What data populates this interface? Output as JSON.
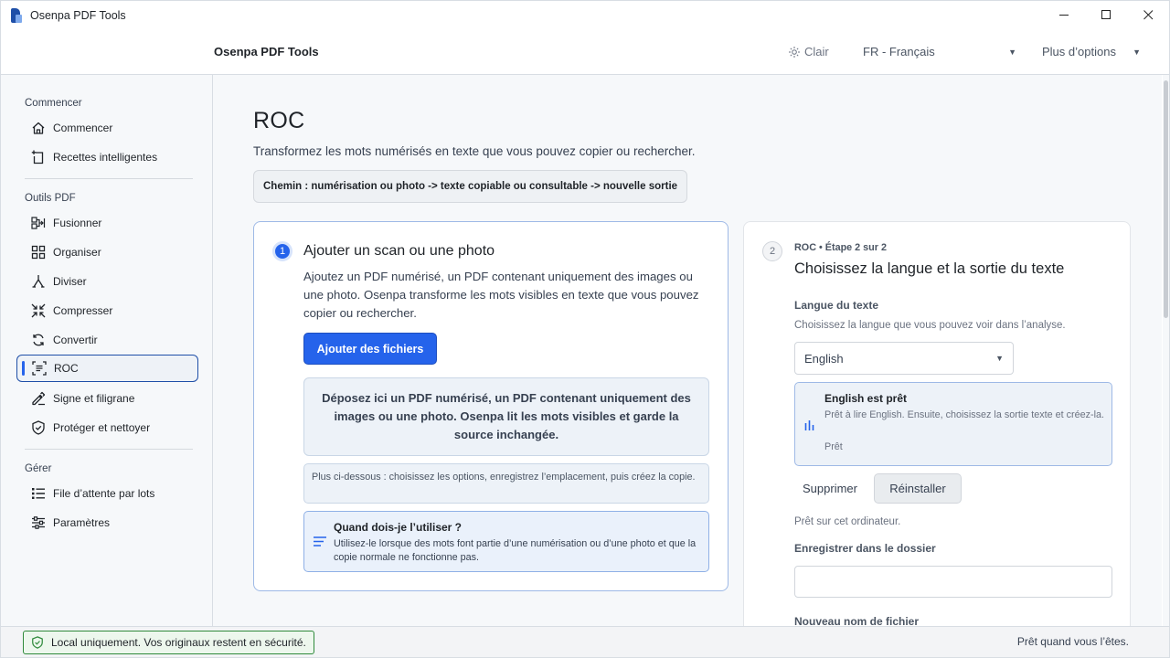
{
  "window": {
    "title": "Osenpa PDF Tools",
    "minimize": "—",
    "maximize": "☐",
    "close": "✕"
  },
  "header": {
    "brand": "Osenpa PDF Tools",
    "theme_label": "Clair",
    "language_value": "FR - Français",
    "more_label": "Plus d’options"
  },
  "sidebar": {
    "sections": [
      {
        "label": "Commencer",
        "items": [
          {
            "label": "Commencer",
            "icon": "home-icon"
          },
          {
            "label": "Recettes intelligentes",
            "icon": "sparkle-doc-icon"
          }
        ]
      },
      {
        "label": "Outils PDF",
        "items": [
          {
            "label": "Fusionner",
            "icon": "merge-icon"
          },
          {
            "label": "Organiser",
            "icon": "grid-icon"
          },
          {
            "label": "Diviser",
            "icon": "split-icon"
          },
          {
            "label": "Compresser",
            "icon": "compress-icon"
          },
          {
            "label": "Convertir",
            "icon": "refresh-icon"
          },
          {
            "label": "ROC",
            "icon": "ocr-icon",
            "active": true
          },
          {
            "label": "Signe et filigrane",
            "icon": "pen-icon"
          },
          {
            "label": "Protéger et nettoyer",
            "icon": "shield-icon"
          }
        ]
      },
      {
        "label": "Gérer",
        "items": [
          {
            "label": "File d’attente par lots",
            "icon": "list-icon"
          },
          {
            "label": "Paramètres",
            "icon": "sliders-icon"
          }
        ]
      }
    ]
  },
  "main": {
    "title": "ROC",
    "subtitle": "Transformez les mots numérisés en texte que vous pouvez copier ou rechercher.",
    "path": "Chemin : numérisation ou photo -> texte copiable ou consultable -> nouvelle sortie",
    "step1": {
      "number": "1",
      "title": "Ajouter un scan ou une photo",
      "description": "Ajoutez un PDF numérisé, un PDF contenant uniquement des images ou une photo. Osenpa transforme les mots visibles en texte que vous pouvez copier ou rechercher.",
      "add_button": "Ajouter des fichiers",
      "dropzone": "Déposez ici un PDF numérisé, un PDF contenant uniquement des images ou une photo. Osenpa lit les mots visibles et garde la source inchangée.",
      "hint": "Plus ci-dessous : choisissez les options, enregistrez l’emplacement, puis créez la copie.",
      "when_title": "Quand dois-je l’utiliser ?",
      "when_text": "Utilisez-le lorsque des mots font partie d’une numérisation ou d’une photo et que la copie normale ne fonctionne pas."
    },
    "step2": {
      "number": "2",
      "kicker": "ROC • Étape 2 sur 2",
      "title": "Choisissez la langue et la sortie du texte",
      "language_label": "Langue du texte",
      "language_help": "Choisissez la langue que vous pouvez voir dans l’analyse.",
      "language_value": "English",
      "ready_title": "English est prêt",
      "ready_desc": "Prêt à lire English. Ensuite, choisissez la sortie texte et créez-la.",
      "ready_status": "Prêt",
      "remove_button": "Supprimer",
      "reinstall_button": "Réinstaller",
      "local_note": "Prêt sur cet ordinateur.",
      "folder_label": "Enregistrer dans le dossier",
      "folder_value": "",
      "filename_label": "Nouveau nom de fichier"
    }
  },
  "status": {
    "left": "Local uniquement. Vos originaux restent en sécurité.",
    "right": "Prêt quand vous l’êtes."
  }
}
